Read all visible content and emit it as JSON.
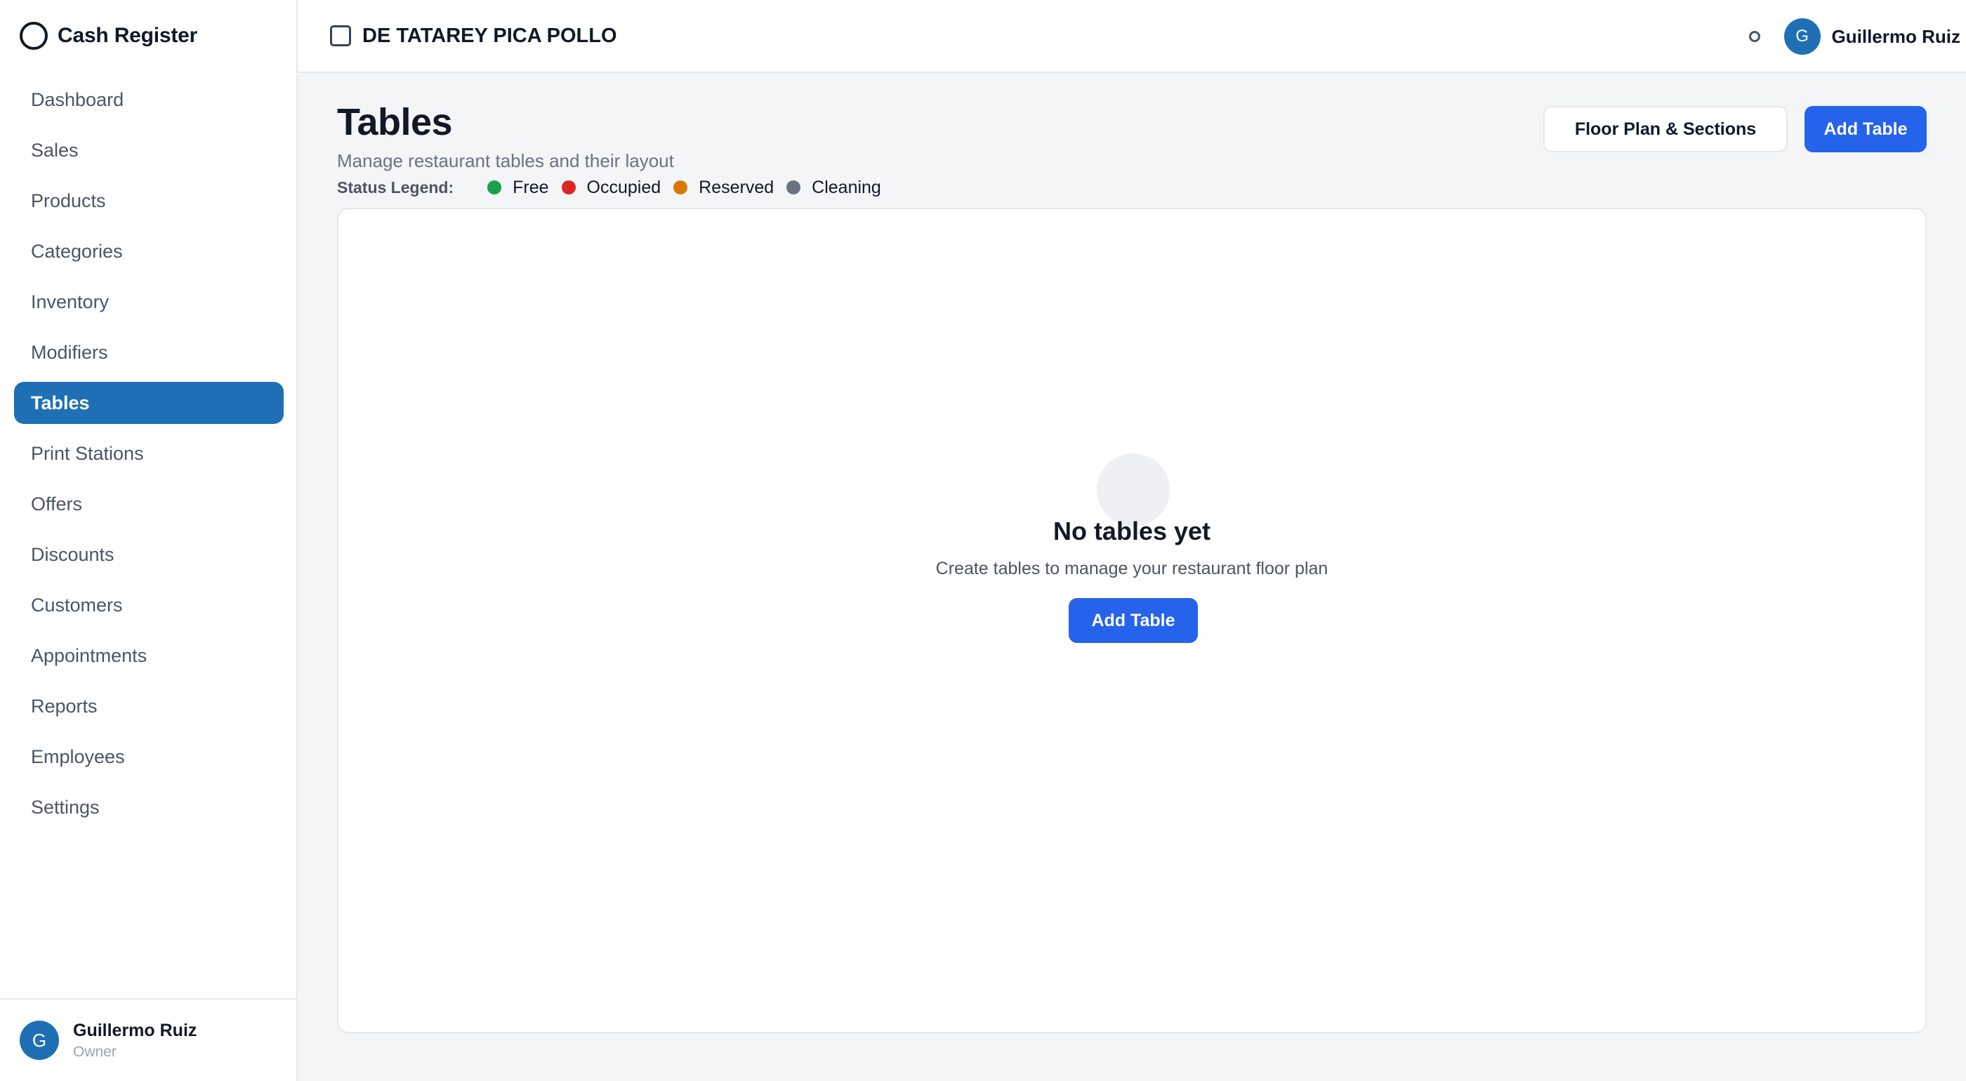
{
  "app": {
    "title": "Cash Register"
  },
  "sidebar": {
    "items": [
      {
        "label": "Dashboard"
      },
      {
        "label": "Sales"
      },
      {
        "label": "Products"
      },
      {
        "label": "Categories"
      },
      {
        "label": "Inventory"
      },
      {
        "label": "Modifiers"
      },
      {
        "label": "Tables",
        "active": true
      },
      {
        "label": "Print Stations"
      },
      {
        "label": "Offers"
      },
      {
        "label": "Discounts"
      },
      {
        "label": "Customers"
      },
      {
        "label": "Appointments"
      },
      {
        "label": "Reports"
      },
      {
        "label": "Employees"
      },
      {
        "label": "Settings"
      }
    ],
    "footer": {
      "initial": "G",
      "name": "Guillermo Ruiz",
      "role": "Owner"
    }
  },
  "header": {
    "store_name": "DE TATAREY PICA POLLO",
    "user": {
      "initial": "G",
      "name": "Guillermo Ruiz"
    }
  },
  "main": {
    "title": "Tables",
    "subtitle": "Manage restaurant tables and their layout",
    "legend": {
      "title": "Status Legend:",
      "items": [
        {
          "label": "Free",
          "color": "#16a34a"
        },
        {
          "label": "Occupied",
          "color": "#dc2626"
        },
        {
          "label": "Reserved",
          "color": "#d97706"
        },
        {
          "label": "Cleaning",
          "color": "#6b7280"
        }
      ]
    },
    "actions": {
      "floor_plan_label": "Floor Plan & Sections",
      "add_table_label": "Add Table"
    },
    "empty_state": {
      "title": "No tables yet",
      "description": "Create tables to manage your restaurant floor plan",
      "button_label": "Add Table"
    }
  },
  "colors": {
    "primary": "#2563eb",
    "active_nav": "#1f6fb5"
  }
}
